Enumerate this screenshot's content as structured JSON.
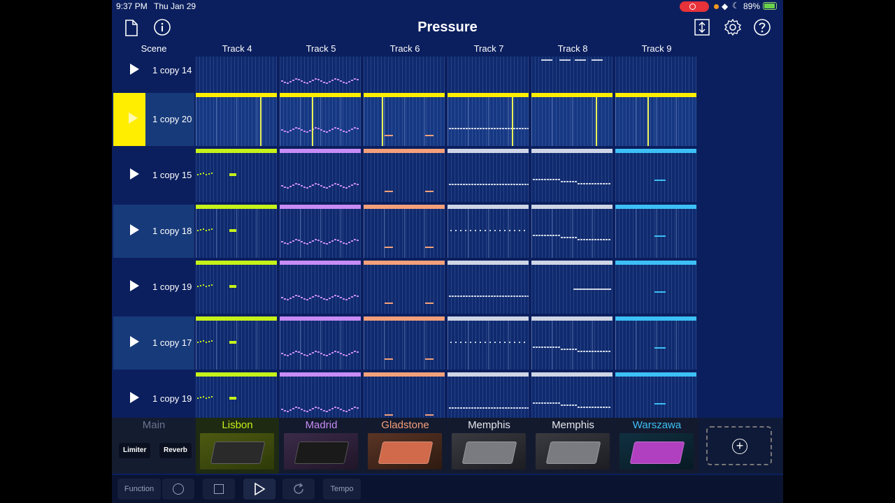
{
  "status": {
    "time": "9:37 PM",
    "date": "Thu Jan 29",
    "battery": "89%"
  },
  "title": "Pressure",
  "header": {
    "scene": "Scene",
    "tracks": [
      "Track 4",
      "Track 5",
      "Track 6",
      "Track 7",
      "Track 8",
      "Track 9"
    ]
  },
  "scenes": [
    {
      "label": "1 copy 14",
      "selected": false,
      "alt": false
    },
    {
      "label": "1 copy 20",
      "selected": true,
      "alt": true
    },
    {
      "label": "1 copy 15",
      "selected": false,
      "alt": false
    },
    {
      "label": "1 copy 18",
      "selected": false,
      "alt": true
    },
    {
      "label": "1 copy 19",
      "selected": false,
      "alt": false
    },
    {
      "label": "1 copy 17",
      "selected": false,
      "alt": true
    },
    {
      "label": "1 copy 19",
      "selected": false,
      "alt": false
    }
  ],
  "track_colors": [
    "#c6f21a",
    "#c78cf5",
    "#f5a07a",
    "#cfd5e6",
    "#cfd5e6",
    "#3cc0f5"
  ],
  "playing_color": "#ffee00",
  "dock": {
    "main": "Main",
    "limiter": "Limiter",
    "reverb": "Reverb",
    "tracks": [
      {
        "name": "Lisbon",
        "color": "#c6f21a"
      },
      {
        "name": "Madrid",
        "color": "#c78cf5"
      },
      {
        "name": "Gladstone",
        "color": "#f5a07a"
      },
      {
        "name": "Memphis",
        "color": "#e6e8ee"
      },
      {
        "name": "Memphis",
        "color": "#e6e8ee"
      },
      {
        "name": "Warszawa",
        "color": "#3cc0f5"
      }
    ]
  },
  "transport": {
    "function": "Function",
    "tempo": "Tempo"
  }
}
